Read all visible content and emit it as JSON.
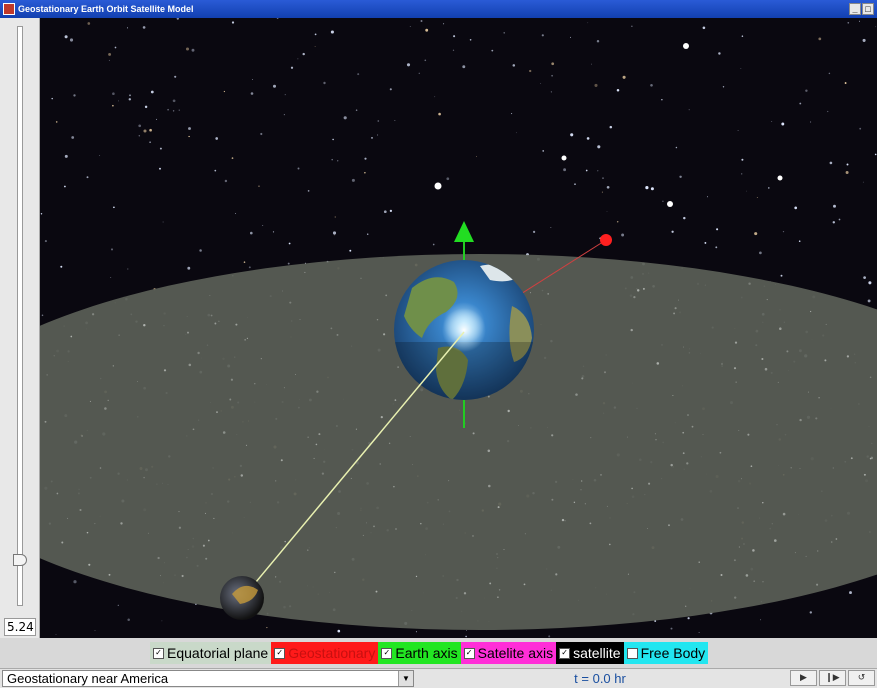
{
  "window": {
    "title": "Geostationary Earth Orbit Satellite Model",
    "controls": {
      "minimize": "_",
      "maximize": "□"
    }
  },
  "zoom": {
    "value": "5.24"
  },
  "checkboxes": [
    {
      "label": "Equatorial plane",
      "checked": true,
      "bg": "#c9d9c9",
      "fg": "#000000"
    },
    {
      "label": "Geostationary",
      "checked": true,
      "bg": "#ff1a1a",
      "fg": "#c81010"
    },
    {
      "label": "Earth axis",
      "checked": true,
      "bg": "#22e622",
      "fg": "#000000"
    },
    {
      "label": "Satelite axis",
      "checked": true,
      "bg": "#ff2ed8",
      "fg": "#000000"
    },
    {
      "label": "satellite",
      "checked": true,
      "bg": "#000000",
      "fg": "#ffffff"
    },
    {
      "label": "Free Body",
      "checked": false,
      "bg": "#22e6f0",
      "fg": "#000000"
    }
  ],
  "status": {
    "scenario": "Geostationary near America",
    "time": "t = 0.0 hr"
  },
  "controls": {
    "play_icon": "▶",
    "step_icon": "❙▶",
    "reset_icon": "↺"
  },
  "colors": {
    "earth_axis": "#22cc22",
    "geostationary_satellite": "#ff2020",
    "equatorial_plane": "#5a5f56",
    "space": "#0a0810"
  }
}
